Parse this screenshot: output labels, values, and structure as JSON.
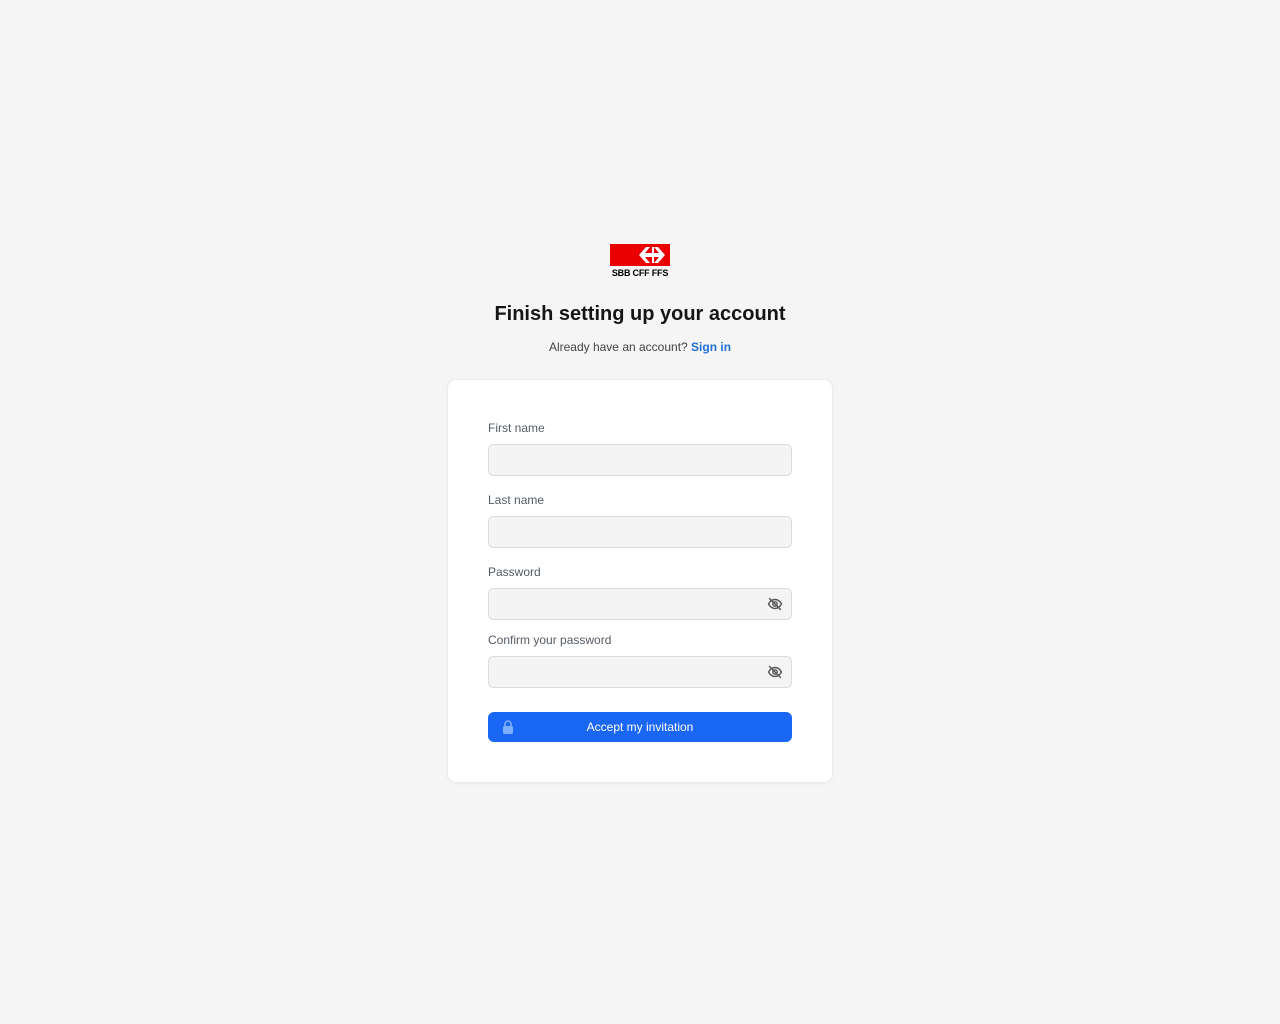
{
  "brand": {
    "logo_text": "SBB CFF FFS",
    "color": "#eb0000"
  },
  "header": {
    "title": "Finish setting up your account",
    "prompt": "Already have an account?",
    "sign_in_label": "Sign in"
  },
  "form": {
    "first_name": {
      "label": "First name",
      "value": "",
      "placeholder": ""
    },
    "last_name": {
      "label": "Last name",
      "value": "",
      "placeholder": ""
    },
    "password": {
      "label": "Password",
      "value": "",
      "placeholder": "",
      "icon": "eye-off-icon"
    },
    "confirm_password": {
      "label": "Confirm your password",
      "value": "",
      "placeholder": "",
      "icon": "eye-off-icon"
    },
    "submit": {
      "label": "Accept my invitation",
      "icon": "lock-icon",
      "color": "#1a66f5"
    }
  },
  "colors": {
    "link": "#1f6fd6",
    "background": "#f5f5f5"
  }
}
